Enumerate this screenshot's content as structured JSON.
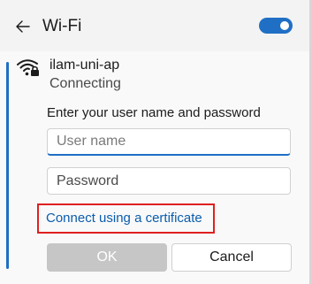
{
  "header": {
    "title": "Wi-Fi",
    "wifi_enabled": true
  },
  "network": {
    "name": "ilam-uni-ap",
    "status": "Connecting",
    "icon": "wifi-secured-icon"
  },
  "form": {
    "prompt": "Enter your user name and password",
    "username_placeholder": "User name",
    "username_value": "",
    "password_placeholder": "Password",
    "password_value": "",
    "certificate_link": "Connect using a certificate",
    "ok_label": "OK",
    "cancel_label": "Cancel"
  },
  "colors": {
    "accent": "#1f6fc5",
    "link": "#0b5cad",
    "highlight_box": "#e02020",
    "disabled_button": "#c6c6c6"
  }
}
